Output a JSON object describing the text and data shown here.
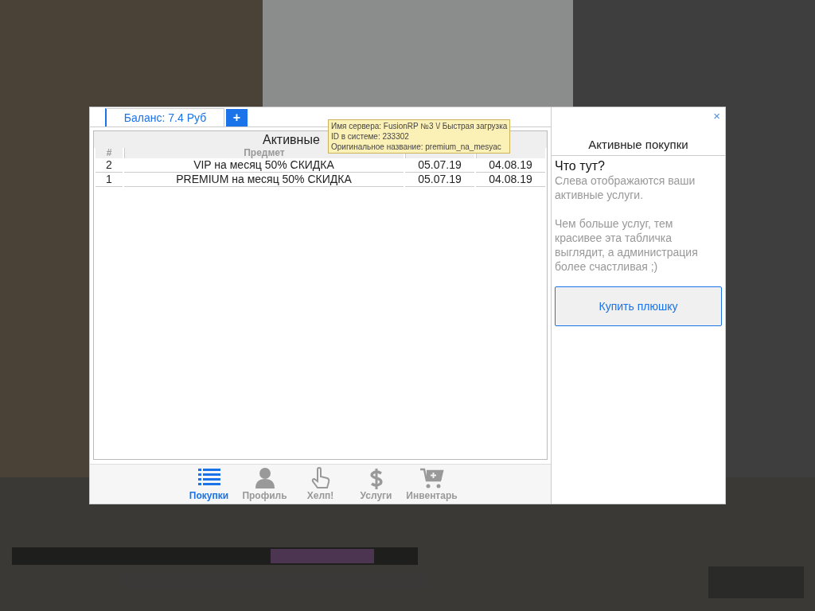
{
  "tabs": [
    {
      "label": "Баланс: 7.4 Руб",
      "selected": true
    }
  ],
  "add_button": "+",
  "close_button": "×",
  "table": {
    "title": "Активные",
    "columns": [
      "#",
      "Предмет"
    ],
    "rows": [
      [
        "2",
        "VIP на месяц 50% СКИДКА",
        "05.07.19",
        "04.08.19"
      ],
      [
        "1",
        "PREMIUM на месяц 50% СКИДКА",
        "05.07.19",
        "04.08.19"
      ]
    ]
  },
  "tooltip": [
    "Имя сервера: FusionRP №3 \\/ Быстрая загрузка",
    "ID в системе: 233302",
    "Оригинальное название: premium_na_mesyac"
  ],
  "info": {
    "title": "Активные покупки",
    "heading": "Что тут?",
    "paragraphs": [
      "Слева отображаются ваши активные услуги.",
      "Чем больше услуг, тем красивее эта табличка выглядит, а администрация более счастливая ;)"
    ],
    "button": "Купить плюшку"
  },
  "nav": [
    {
      "kind": "list",
      "label": "Покупки",
      "selected": true
    },
    {
      "kind": "person",
      "label": "Профиль",
      "selected": false
    },
    {
      "kind": "hand",
      "label": "Хелп!",
      "selected": false
    },
    {
      "kind": "dollar",
      "label": "Услуги",
      "selected": false
    },
    {
      "kind": "cart",
      "label": "Инвентарь",
      "selected": false
    }
  ]
}
